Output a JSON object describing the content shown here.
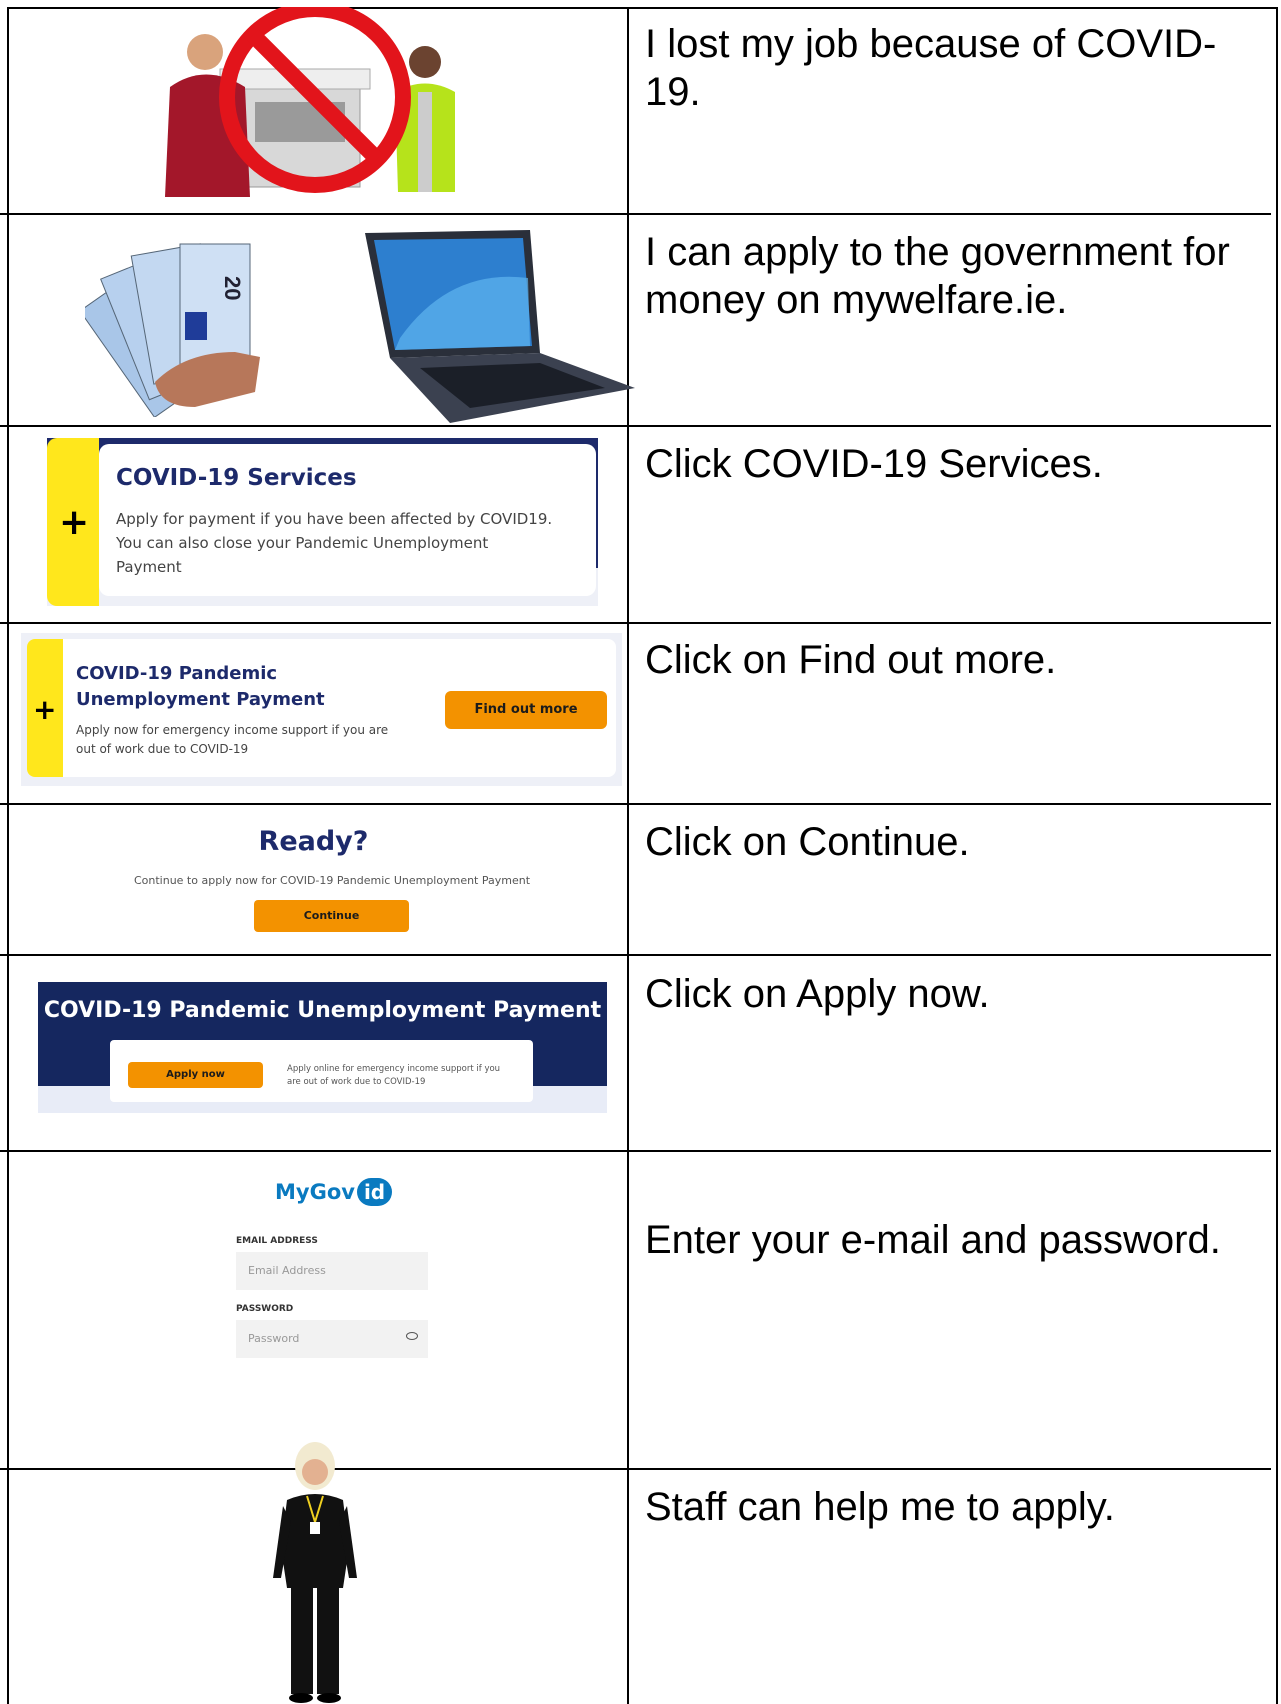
{
  "rows": [
    {
      "text": "I lost my job because of COVID-19."
    },
    {
      "text": "I can apply to the government for money on mywelfare.ie."
    },
    {
      "text": "Click COVID-19 Services."
    },
    {
      "text": "Click on Find out more."
    },
    {
      "text": "Click on Continue."
    },
    {
      "text": "Click on Apply now."
    },
    {
      "text": "Enter your e-mail and password."
    },
    {
      "text": "Staff can help me to apply."
    }
  ],
  "services_card": {
    "title": "COVID-19 Services",
    "line1": "Apply for payment if you have been affected by COVID19.",
    "line2": "You can also close your Pandemic Unemployment",
    "line3": "Payment"
  },
  "pup_card": {
    "title1": "COVID-19 Pandemic",
    "title2": "Unemployment Payment",
    "desc1": "Apply now for emergency income support if you are",
    "desc2": "out of work due to COVID-19",
    "button": "Find out more"
  },
  "ready": {
    "title": "Ready?",
    "desc": "Continue to apply now for COVID-19 Pandemic Unemployment Payment",
    "button": "Continue"
  },
  "apply_banner": {
    "title": "COVID-19 Pandemic Unemployment Payment",
    "button": "Apply now",
    "desc1": "Apply online for emergency income support if you",
    "desc2": "are out of work due to COVID-19"
  },
  "mygovid": {
    "logo_text": "MyGov",
    "logo_badge": "id",
    "email_label": "EMAIL ADDRESS",
    "email_placeholder": "Email Address",
    "password_label": "PASSWORD",
    "password_placeholder": "Password"
  },
  "banknote_label": "20",
  "colors": {
    "navy": "#1d2a6b",
    "yellow": "#ffe71c",
    "orange": "#f39200",
    "mygovid_blue": "#0a7ac0"
  }
}
